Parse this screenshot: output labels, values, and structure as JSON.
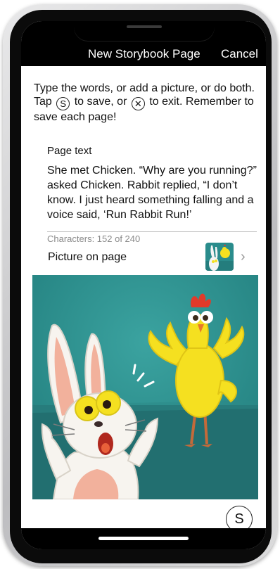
{
  "navbar": {
    "title": "New Storybook Page",
    "cancel_label": "Cancel"
  },
  "instructions": {
    "line1": "Type the words, or add a picture, or do both.",
    "tap": "Tap",
    "save_glyph": "S",
    "to_save": "to save, or",
    "exit_glyph": "✕",
    "to_exit": "to exit. Remember to save each page!"
  },
  "page_text": {
    "label": "Page text",
    "value": "She met Chicken. “Why are you running?” asked Chicken. Rabbit replied, “I don’t know. I just heard something falling and a voice said, ‘Run Rabbit Run!’",
    "char_count": "Characters: 152 of 240"
  },
  "picture": {
    "label": "Picture on page",
    "thumbnail_icon": "rabbit-chicken-thumbnail",
    "chevron_icon": "chevron-right-icon",
    "chevron": "›"
  },
  "save_button": {
    "label": "S"
  },
  "colors": {
    "background": "#ffffff",
    "navbar": "#000000",
    "teal": "#2a8c8c",
    "chicken_yellow": "#f5e020",
    "rabbit_pink": "#f2b19c"
  }
}
